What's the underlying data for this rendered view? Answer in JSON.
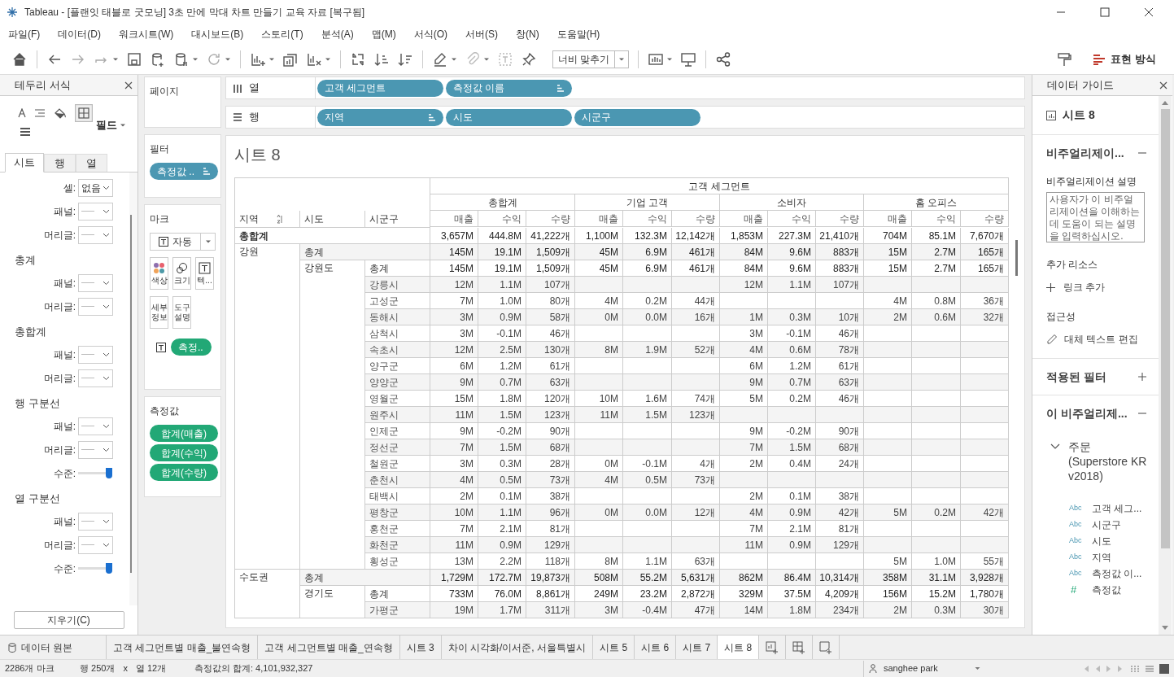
{
  "window": {
    "title": "Tableau - [플랜잇 태블로 굿모닝] 3초 만에 막대 차트 만들기 교육 자료 [복구됨]"
  },
  "menu": [
    "파일(F)",
    "데이터(D)",
    "워크시트(W)",
    "대시보드(B)",
    "스토리(T)",
    "분석(A)",
    "맵(M)",
    "서식(O)",
    "서버(S)",
    "창(N)",
    "도움말(H)"
  ],
  "toolbar": {
    "fit": "너비 맞추기",
    "presentation": "표현 방식"
  },
  "format_panel": {
    "title": "테두리 서식",
    "field_menu": "필드",
    "tabs": [
      {
        "label": "시트",
        "selected": true
      },
      {
        "label": "행",
        "selected": false
      },
      {
        "label": "열",
        "selected": false
      }
    ],
    "sections": [
      {
        "items": [
          {
            "kind": "dropdown",
            "label": "셀:",
            "value": "없음"
          },
          {
            "kind": "dropdown",
            "label": "패널:"
          },
          {
            "kind": "dropdown",
            "label": "머리글:"
          }
        ]
      },
      {
        "title": "총계",
        "items": [
          {
            "kind": "dropdown",
            "label": "패널:"
          },
          {
            "kind": "dropdown",
            "label": "머리글:"
          }
        ]
      },
      {
        "title": "총합계",
        "items": [
          {
            "kind": "dropdown",
            "label": "패널:"
          },
          {
            "kind": "dropdown",
            "label": "머리글:"
          }
        ]
      },
      {
        "title": "행 구분선",
        "items": [
          {
            "kind": "dropdown",
            "label": "패널:"
          },
          {
            "kind": "dropdown",
            "label": "머리글:"
          },
          {
            "kind": "slider",
            "label": "수준:",
            "level": 1
          }
        ]
      },
      {
        "title": "열 구분선",
        "items": [
          {
            "kind": "dropdown",
            "label": "패널:"
          },
          {
            "kind": "dropdown",
            "label": "머리글:"
          },
          {
            "kind": "slider",
            "label": "수준:",
            "level": 1
          }
        ]
      }
    ],
    "clear_button": "지우기(C)"
  },
  "cards": {
    "pages": "페이지",
    "filters": {
      "title": "필터",
      "pills": [
        {
          "label": "측정값 ..",
          "color": "#4b97b2",
          "sort_icon": true
        }
      ]
    },
    "marks": {
      "title": "마크",
      "mark_type": "자동",
      "buttons": [
        {
          "kind": "color",
          "label": "색상"
        },
        {
          "kind": "size",
          "label": "크기"
        },
        {
          "kind": "text",
          "label": "텍..."
        },
        {
          "kind": "detail",
          "label": "세부\n정보"
        },
        {
          "kind": "tooltip",
          "label": "도구\n설명"
        }
      ],
      "pills": [
        {
          "label": "측정..",
          "color": "#22a876"
        }
      ]
    },
    "measure_values": {
      "title": "측정값",
      "pills": [
        {
          "label": "합계(매출)",
          "color": "#22a876"
        },
        {
          "label": "합계(수익)",
          "color": "#22a876"
        },
        {
          "label": "합계(수량)",
          "color": "#22a876"
        }
      ]
    }
  },
  "columns_shelf": {
    "label": "열",
    "pills": [
      {
        "label": "고객 세그먼트",
        "color": "#4b97b2",
        "sort_icon": false
      },
      {
        "label": "측정값 이름",
        "color": "#4b97b2",
        "sort_icon": true
      }
    ]
  },
  "rows_shelf": {
    "label": "행",
    "pills": [
      {
        "label": "지역",
        "color": "#4b97b2",
        "sort_icon": true
      },
      {
        "label": "시도",
        "color": "#4b97b2",
        "sort_icon": false
      },
      {
        "label": "시군구",
        "color": "#4b97b2",
        "sort_icon": false
      }
    ]
  },
  "view": {
    "title": "시트 8",
    "table": {
      "column_header": "고객 세그먼트",
      "row_headers": [
        "지역",
        "시도",
        "시군구"
      ],
      "segments": [
        {
          "label": "총합계",
          "measures": [
            "매출",
            "수익",
            "수량"
          ]
        },
        {
          "label": "기업 고객",
          "measures": [
            "매출",
            "수익",
            "수량"
          ]
        },
        {
          "label": "소비자",
          "measures": [
            "매출",
            "수익",
            "수량"
          ]
        },
        {
          "label": "홈 오피스",
          "measures": [
            "매출",
            "수익",
            "수량"
          ]
        }
      ],
      "rows": [
        {
          "kind": "grand",
          "label": "총합계",
          "total": [
            "3,657M",
            "444.8M",
            "41,222개"
          ],
          "corporate": [
            "1,100M",
            "132.3M",
            "12,142개"
          ],
          "consumer": [
            "1,853M",
            "227.3M",
            "21,410개"
          ],
          "home_office": [
            "704M",
            "85.1M",
            "7,670개"
          ]
        },
        {
          "kind": "region",
          "region": "강원",
          "label": "총계",
          "total": [
            "145M",
            "19.1M",
            "1,509개"
          ],
          "corporate": [
            "45M",
            "6.9M",
            "461개"
          ],
          "consumer": [
            "84M",
            "9.6M",
            "883개"
          ],
          "home_office": [
            "15M",
            "2.7M",
            "165개"
          ]
        },
        {
          "kind": "province",
          "province": "강원도",
          "label": "총계",
          "total": [
            "145M",
            "19.1M",
            "1,509개"
          ],
          "corporate": [
            "45M",
            "6.9M",
            "461개"
          ],
          "consumer": [
            "84M",
            "9.6M",
            "883개"
          ],
          "home_office": [
            "15M",
            "2.7M",
            "165개"
          ]
        },
        {
          "kind": "district",
          "label": "강릉시",
          "total": [
            "12M",
            "1.1M",
            "107개"
          ],
          "consumer": [
            "12M",
            "1.1M",
            "107개"
          ]
        },
        {
          "kind": "district",
          "label": "고성군",
          "total": [
            "7M",
            "1.0M",
            "80개"
          ],
          "corporate": [
            "4M",
            "0.2M",
            "44개"
          ],
          "home_office": [
            "4M",
            "0.8M",
            "36개"
          ]
        },
        {
          "kind": "district",
          "label": "동해시",
          "total": [
            "3M",
            "0.9M",
            "58개"
          ],
          "corporate": [
            "0M",
            "0.0M",
            "16개"
          ],
          "consumer": [
            "1M",
            "0.3M",
            "10개"
          ],
          "home_office": [
            "2M",
            "0.6M",
            "32개"
          ]
        },
        {
          "kind": "district",
          "label": "삼척시",
          "total": [
            "3M",
            "-0.1M",
            "46개"
          ],
          "consumer": [
            "3M",
            "-0.1M",
            "46개"
          ]
        },
        {
          "kind": "district",
          "label": "속초시",
          "total": [
            "12M",
            "2.5M",
            "130개"
          ],
          "corporate": [
            "8M",
            "1.9M",
            "52개"
          ],
          "consumer": [
            "4M",
            "0.6M",
            "78개"
          ]
        },
        {
          "kind": "district",
          "label": "양구군",
          "total": [
            "6M",
            "1.2M",
            "61개"
          ],
          "consumer": [
            "6M",
            "1.2M",
            "61개"
          ]
        },
        {
          "kind": "district",
          "label": "양양군",
          "total": [
            "9M",
            "0.7M",
            "63개"
          ],
          "consumer": [
            "9M",
            "0.7M",
            "63개"
          ]
        },
        {
          "kind": "district",
          "label": "영월군",
          "total": [
            "15M",
            "1.8M",
            "120개"
          ],
          "corporate": [
            "10M",
            "1.6M",
            "74개"
          ],
          "consumer": [
            "5M",
            "0.2M",
            "46개"
          ]
        },
        {
          "kind": "district",
          "label": "원주시",
          "total": [
            "11M",
            "1.5M",
            "123개"
          ],
          "corporate": [
            "11M",
            "1.5M",
            "123개"
          ]
        },
        {
          "kind": "district",
          "label": "인제군",
          "total": [
            "9M",
            "-0.2M",
            "90개"
          ],
          "consumer": [
            "9M",
            "-0.2M",
            "90개"
          ]
        },
        {
          "kind": "district",
          "label": "정선군",
          "total": [
            "7M",
            "1.5M",
            "68개"
          ],
          "consumer": [
            "7M",
            "1.5M",
            "68개"
          ]
        },
        {
          "kind": "district",
          "label": "철원군",
          "total": [
            "3M",
            "0.3M",
            "28개"
          ],
          "corporate": [
            "0M",
            "-0.1M",
            "4개"
          ],
          "consumer": [
            "2M",
            "0.4M",
            "24개"
          ]
        },
        {
          "kind": "district",
          "label": "춘천시",
          "total": [
            "4M",
            "0.5M",
            "73개"
          ],
          "corporate": [
            "4M",
            "0.5M",
            "73개"
          ]
        },
        {
          "kind": "district",
          "label": "태백시",
          "total": [
            "2M",
            "0.1M",
            "38개"
          ],
          "consumer": [
            "2M",
            "0.1M",
            "38개"
          ]
        },
        {
          "kind": "district",
          "label": "평창군",
          "total": [
            "10M",
            "1.1M",
            "96개"
          ],
          "corporate": [
            "0M",
            "0.0M",
            "12개"
          ],
          "consumer": [
            "4M",
            "0.9M",
            "42개"
          ],
          "home_office": [
            "5M",
            "0.2M",
            "42개"
          ]
        },
        {
          "kind": "district",
          "label": "홍천군",
          "total": [
            "7M",
            "2.1M",
            "81개"
          ],
          "consumer": [
            "7M",
            "2.1M",
            "81개"
          ]
        },
        {
          "kind": "district",
          "label": "화천군",
          "total": [
            "11M",
            "0.9M",
            "129개"
          ],
          "consumer": [
            "11M",
            "0.9M",
            "129개"
          ]
        },
        {
          "kind": "district",
          "label": "횡성군",
          "total": [
            "13M",
            "2.2M",
            "118개"
          ],
          "corporate": [
            "8M",
            "1.1M",
            "63개"
          ],
          "home_office": [
            "5M",
            "1.0M",
            "55개"
          ]
        },
        {
          "kind": "region",
          "region": "수도권",
          "label": "총계",
          "total": [
            "1,729M",
            "172.7M",
            "19,873개"
          ],
          "corporate": [
            "508M",
            "55.2M",
            "5,631개"
          ],
          "consumer": [
            "862M",
            "86.4M",
            "10,314개"
          ],
          "home_office": [
            "358M",
            "31.1M",
            "3,928개"
          ]
        },
        {
          "kind": "province",
          "province": "경기도",
          "label": "총계",
          "total": [
            "733M",
            "76.0M",
            "8,861개"
          ],
          "corporate": [
            "249M",
            "23.2M",
            "2,872개"
          ],
          "consumer": [
            "329M",
            "37.5M",
            "4,209개"
          ],
          "home_office": [
            "156M",
            "15.2M",
            "1,780개"
          ]
        },
        {
          "kind": "district",
          "label": "가평군",
          "total": [
            "19M",
            "1.7M",
            "311개"
          ],
          "corporate": [
            "3M",
            "-0.4M",
            "47개"
          ],
          "consumer": [
            "14M",
            "1.8M",
            "234개"
          ],
          "home_office": [
            "2M",
            "0.3M",
            "30개"
          ]
        }
      ]
    }
  },
  "data_guide": {
    "title": "데이터 가이드",
    "sheet": "시트 8",
    "viz_section": "비주얼리제이...",
    "description_label": "비주얼리제이션 설명",
    "description_placeholder": "사용자가 이 비주얼리제이션을 이해하는 데 도움이 되는 설명을 입력하십시오.",
    "resources_label": "추가 리소스",
    "add_link": "링크 추가",
    "accessibility_label": "접근성",
    "edit_alt_text": "대체 텍스트 편집",
    "filters_section": "적용된 필터",
    "fields_section": "이 비주얼리제...",
    "source": {
      "name": "주문 (Superstore KR v2018)",
      "expanded": true,
      "fields": [
        {
          "type": "Abc",
          "name": "고객 세그..."
        },
        {
          "type": "Abc",
          "name": "시군구"
        },
        {
          "type": "Abc",
          "name": "시도"
        },
        {
          "type": "Abc",
          "name": "지역"
        },
        {
          "type": "Abc",
          "name": "측정값 이..."
        },
        {
          "type": "#",
          "name": "측정값"
        }
      ]
    }
  },
  "sheet_tabs": [
    {
      "kind": "datasource",
      "label": "데이터 원본",
      "selected": false
    },
    {
      "kind": "sheet",
      "label": "고객 세그먼트별 매출_불연속형",
      "selected": false
    },
    {
      "kind": "sheet",
      "label": "고객 세그먼트별 매출_연속형",
      "selected": false
    },
    {
      "kind": "sheet",
      "label": "시트 3",
      "selected": false
    },
    {
      "kind": "sheet",
      "label": "차이 시각화/이서준, 서울특별시",
      "selected": false
    },
    {
      "kind": "sheet",
      "label": "시트 5",
      "selected": false
    },
    {
      "kind": "sheet",
      "label": "시트 6",
      "selected": false
    },
    {
      "kind": "sheet",
      "label": "시트 7",
      "selected": false
    },
    {
      "kind": "sheet",
      "label": "시트 8",
      "selected": true
    }
  ],
  "status_bar": {
    "marks": "2286개 마크",
    "rows": "행 250개",
    "times": "x",
    "columns": "열 12개",
    "sum": "측정값의 합계: 4,101,932,327",
    "user": "sanghee park"
  }
}
